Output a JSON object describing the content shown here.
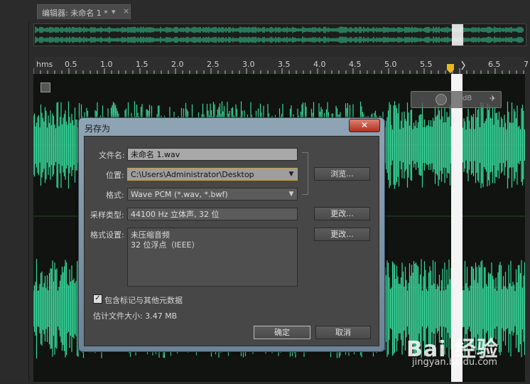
{
  "editor": {
    "tab_title": "编辑器: 未命名 1 *",
    "tab_menu": "▾",
    "tab_close": "×"
  },
  "timeline": {
    "unit": "hms",
    "ticks": [
      "0.5",
      "1.0",
      "1.5",
      "2.0",
      "2.5",
      "3.0",
      "3.5",
      "4.0",
      "4.5",
      "5.0",
      "5.5",
      "6.5",
      "7"
    ]
  },
  "hud": {
    "label": "dB",
    "pin_icon": "pin-icon"
  },
  "dialog": {
    "title": "另存为",
    "close_glyph": "✕",
    "filename_label": "文件名:",
    "filename_value": "未命名 1.wav",
    "location_label": "位置:",
    "location_value": "C:\\Users\\Administrator\\Desktop",
    "browse_label": "浏览...",
    "format_label": "格式:",
    "format_value": "Wave PCM (*.wav, *.bwf)",
    "sample_label": "采样类型:",
    "sample_value": "44100 Hz 立体声, 32 位",
    "sample_change": "更改...",
    "format_settings_label": "格式设置:",
    "format_settings_line1": "未压缩音频",
    "format_settings_line2": "32 位浮点（IEEE）",
    "format_change": "更改...",
    "metadata_checkbox": "包含标记与其他元数据",
    "metadata_checked": true,
    "filesize_label": "估计文件大小: 3.47 MB",
    "ok_label": "确定",
    "cancel_label": "取消"
  },
  "watermark": {
    "brand": "Bai 经验",
    "url": "jingyan.baidu.com"
  },
  "colors": {
    "waveform": "#39d69a",
    "playhead": "#ffffff",
    "dialog_frame": "#7f97a8",
    "close_button": "#c8402c"
  }
}
